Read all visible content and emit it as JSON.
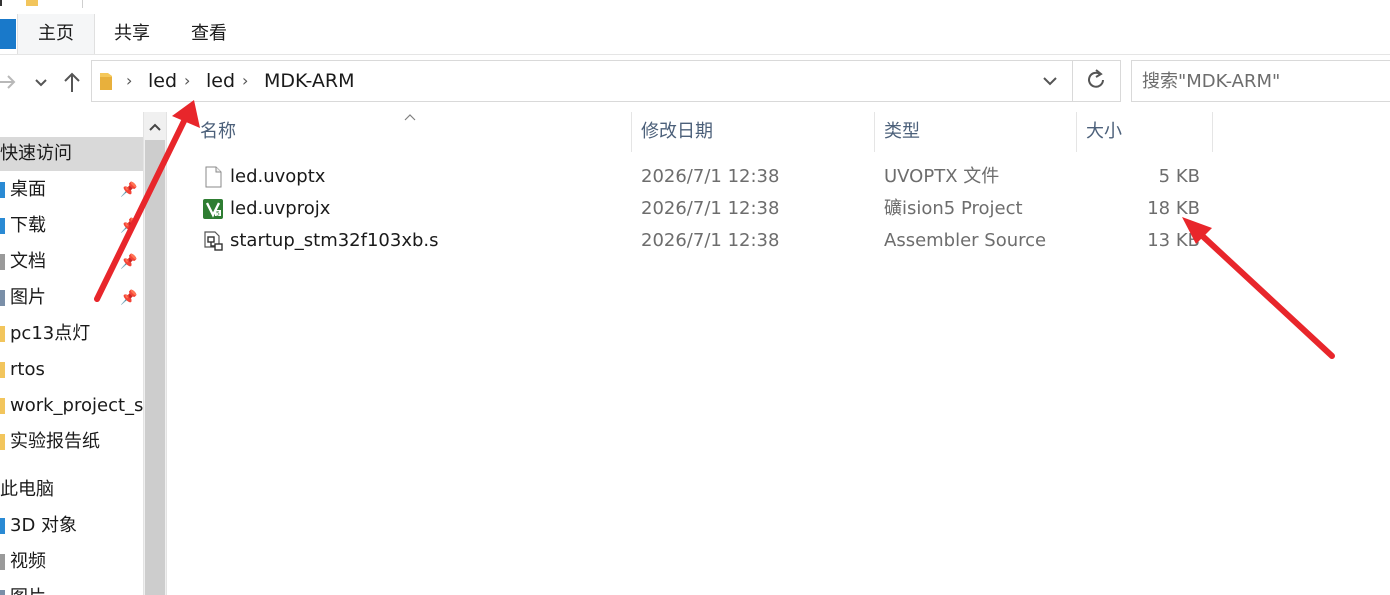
{
  "ribbon": {
    "tabs": [
      {
        "label": "主页"
      },
      {
        "label": "共享"
      },
      {
        "label": "查看"
      }
    ]
  },
  "address": {
    "breadcrumbs": [
      "led",
      "led",
      "MDK-ARM"
    ]
  },
  "search": {
    "placeholder": "搜索\"MDK-ARM\""
  },
  "sidebar": {
    "quick_access": "快速访问",
    "items": [
      {
        "label": "桌面",
        "pinned": true
      },
      {
        "label": "下载",
        "pinned": true
      },
      {
        "label": "文档",
        "pinned": true
      },
      {
        "label": "图片",
        "pinned": true
      },
      {
        "label": "pc13点灯"
      },
      {
        "label": "rtos"
      },
      {
        "label": "work_project_se"
      },
      {
        "label": "实验报告纸"
      }
    ],
    "this_pc": "此电脑",
    "pc_items": [
      {
        "label": "3D 对象"
      },
      {
        "label": "视频"
      },
      {
        "label": "图片"
      }
    ]
  },
  "columns": {
    "name": "名称",
    "date": "修改日期",
    "type": "类型",
    "size": "大小"
  },
  "files": [
    {
      "name": "led.uvoptx",
      "date": "2026/7/1 12:38",
      "type": "UVOPTX 文件",
      "size": "5 KB",
      "icon": "blank-file-icon"
    },
    {
      "name": "led.uvprojx",
      "date": "2026/7/1 12:38",
      "type": "礦ision5 Project",
      "size": "18 KB",
      "icon": "keil-project-icon"
    },
    {
      "name": "startup_stm32f103xb.s",
      "date": "2026/7/1 12:38",
      "type": "Assembler Source",
      "size": "13 KB",
      "icon": "assembler-source-icon"
    }
  ],
  "colors": {
    "accent": "#1979ca",
    "annotation_arrow": "#e8262b",
    "header_text": "#4c607a",
    "selected_bg": "#d9d9d9"
  }
}
